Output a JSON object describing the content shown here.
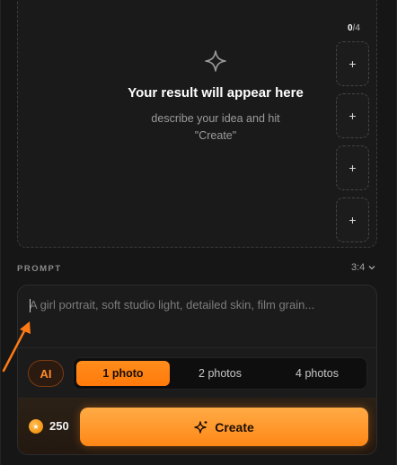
{
  "result": {
    "counter_current": "0",
    "counter_total": "/4",
    "title": "Your result will appear here",
    "subtitle_line1": "describe your idea and hit",
    "subtitle_line2": "\"Create\"",
    "slots": [
      "+",
      "+",
      "+",
      "+"
    ]
  },
  "prompt": {
    "label": "PROMPT",
    "ratio": "3:4",
    "placeholder": "A girl portrait, soft studio light, detailed skin, film grain...",
    "value": ""
  },
  "controls": {
    "ai_label": "AI",
    "photo_options": [
      "1 photo",
      "2 photos",
      "4 photos"
    ],
    "selected_option": "1 photo"
  },
  "footer": {
    "credits": "250",
    "create_label": "Create"
  },
  "colors": {
    "accent": "#ff8716",
    "background": "#161616"
  },
  "icons": {
    "sparkle": "sparkle-icon",
    "chevron": "chevron-down-icon",
    "coin": "coin-icon",
    "create": "sparkles-icon",
    "annotation": "arrow-annotation"
  }
}
